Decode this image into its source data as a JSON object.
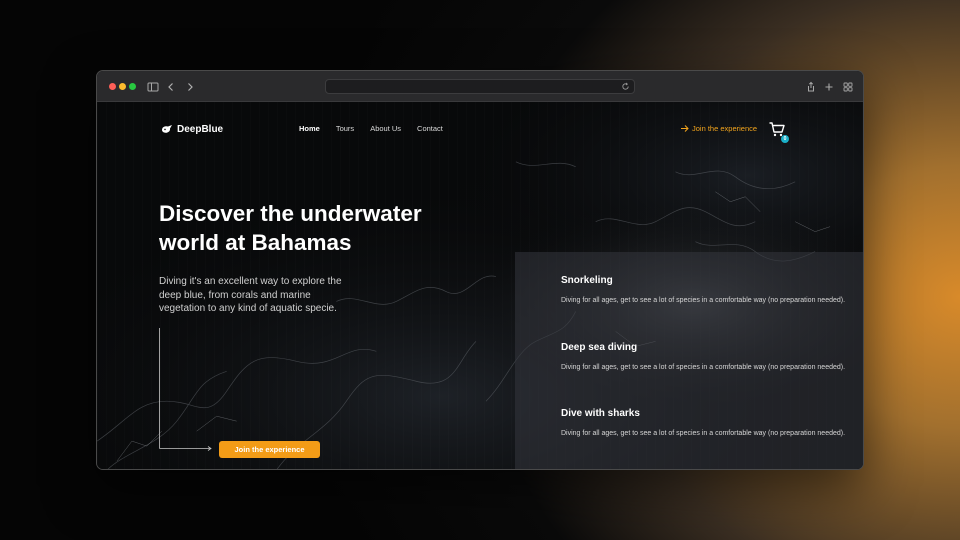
{
  "browser": {
    "url": ""
  },
  "site": {
    "logo_text": "DeepBlue",
    "nav": {
      "home": "Home",
      "tours": "Tours",
      "about": "About Us",
      "contact": "Contact"
    },
    "cta_top": "Join the experience",
    "cart_count": "0"
  },
  "hero": {
    "title": "Discover the underwater world at Bahamas",
    "text": "Diving it's an excellent way to explore the deep blue, from corals and marine vegetation to any kind of aquatic specie.",
    "button": "Join the experience"
  },
  "activities": [
    {
      "title": "Snorkeling",
      "text": "Diving for all ages, get to see a lot of species in a comfortable way (no preparation needed)."
    },
    {
      "title": "Deep sea diving",
      "text": "Diving for all ages, get to see a lot of species in a comfortable way (no preparation needed)."
    },
    {
      "title": "Dive with sharks",
      "text": "Diving for all ages, get to see a lot of species in a comfortable way (no preparation needed)."
    }
  ],
  "colors": {
    "accent": "#f39c17",
    "badge": "#1ab0c8",
    "background": "#08090a"
  },
  "icons": [
    "sidebar-toggle-icon",
    "back-icon",
    "forward-icon",
    "reload-icon",
    "share-icon",
    "new-tab-icon",
    "tab-overview-icon",
    "logo-icon",
    "arrow-right-icon",
    "cart-icon"
  ]
}
